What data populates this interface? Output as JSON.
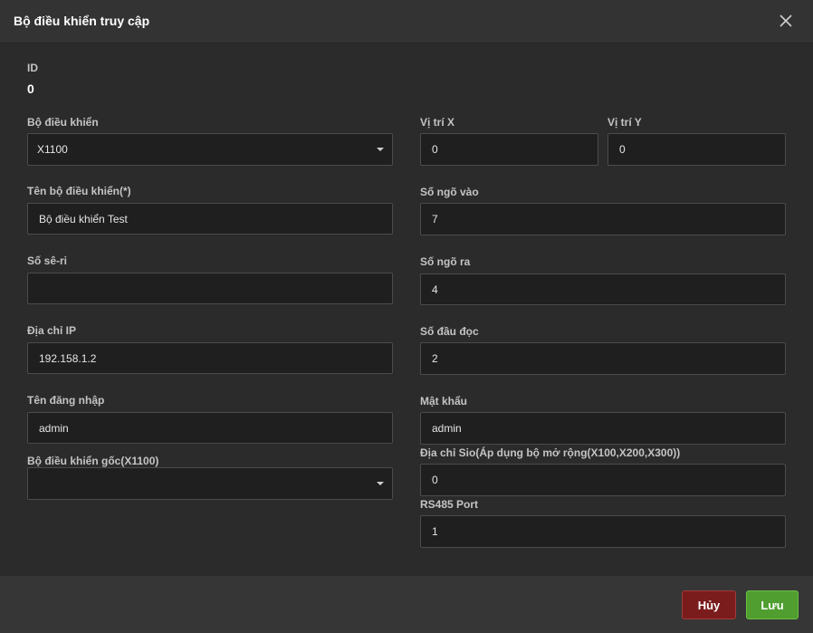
{
  "dialog": {
    "title": "Bộ điều khiển truy cập",
    "close_icon": "close-icon"
  },
  "id": {
    "label": "ID",
    "value": "0"
  },
  "left": {
    "controller": {
      "label": "Bộ điều khiển",
      "value": "X1100"
    },
    "name": {
      "label": "Tên bộ điều khiển(*)",
      "value": "Bộ điều khiển Test"
    },
    "serial": {
      "label": "Số sê-ri",
      "value": ""
    },
    "ip": {
      "label": "Địa chỉ IP",
      "value": "192.158.1.2"
    },
    "username": {
      "label": "Tên đăng nhập",
      "value": "admin"
    },
    "root_controller": {
      "label": "Bộ điều khiển gốc(X1100)",
      "value": ""
    }
  },
  "right": {
    "pos_x": {
      "label": "Vị trí X",
      "value": "0"
    },
    "pos_y": {
      "label": "Vị trí Y",
      "value": "0"
    },
    "inputs": {
      "label": "Số ngõ vào",
      "value": "7"
    },
    "outputs": {
      "label": "Số ngõ ra",
      "value": "4"
    },
    "readers": {
      "label": "Số đầu đọc",
      "value": "2"
    },
    "password": {
      "label": "Mật khẩu",
      "value": "admin"
    },
    "sio": {
      "label": "Địa chỉ Sio(Áp dụng bộ mở rộng(X100,X200,X300))",
      "value": "0"
    },
    "rs485": {
      "label": "RS485 Port",
      "value": "1"
    }
  },
  "footer": {
    "cancel_label": "Hủy",
    "save_label": "Lưu"
  }
}
